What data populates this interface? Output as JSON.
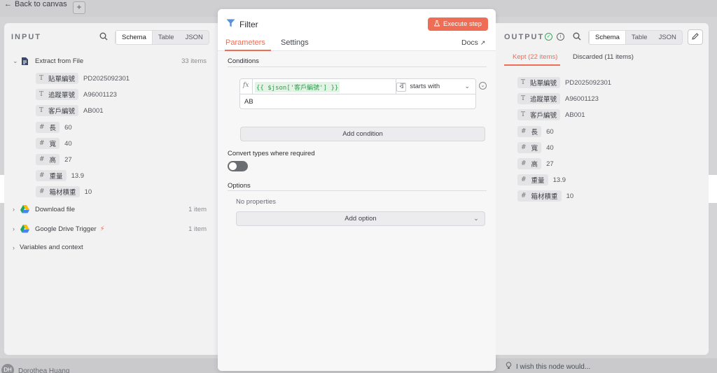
{
  "topbar": {
    "back_label": "Back to canvas",
    "plus": "+"
  },
  "canvas": {
    "user_initials": "DH",
    "user_name": "Dorothea Huang",
    "feedback": "I wish this node would..."
  },
  "input": {
    "title": "INPUT",
    "view_tabs": [
      "Schema",
      "Table",
      "JSON"
    ],
    "active_tab": "Schema",
    "nodes": [
      {
        "name": "Extract from File",
        "count": "33 items",
        "expanded": true
      },
      {
        "name": "Download file",
        "count": "1 item",
        "expanded": false
      },
      {
        "name": "Google Drive Trigger",
        "count": "1 item",
        "expanded": false
      },
      {
        "name": "Variables and context"
      }
    ],
    "fields": [
      {
        "type": "T",
        "name": "貼單編號",
        "value": "PD2025092301"
      },
      {
        "type": "T",
        "name": "追蹤單號",
        "value": "A96001123"
      },
      {
        "type": "T",
        "name": "客戶編號",
        "value": "AB001"
      },
      {
        "type": "#",
        "name": "長",
        "value": "60"
      },
      {
        "type": "#",
        "name": "寬",
        "value": "40"
      },
      {
        "type": "#",
        "name": "高",
        "value": "27"
      },
      {
        "type": "#",
        "name": "重量",
        "value": "13.9"
      },
      {
        "type": "#",
        "name": "箱材積重",
        "value": "10"
      }
    ]
  },
  "modal": {
    "title": "Filter",
    "execute_label": "Execute step",
    "tabs": [
      "Parameters",
      "Settings"
    ],
    "docs_label": "Docs",
    "conditions_label": "Conditions",
    "condition": {
      "fx": "fx",
      "left_value": "{{ $json['客戶編號'] }}",
      "operator_type": "T",
      "operator": "starts with",
      "right_value": "AB"
    },
    "add_condition_label": "Add condition",
    "convert_types_label": "Convert types where required",
    "convert_types_on": false,
    "options_label": "Options",
    "no_properties": "No properties",
    "add_option_label": "Add option"
  },
  "output": {
    "title": "OUTPUT",
    "view_tabs": [
      "Schema",
      "Table",
      "JSON"
    ],
    "active_tab": "Schema",
    "kept_label": "Kept (22 items)",
    "discarded_label": "Discarded (11 items)",
    "fields": [
      {
        "type": "T",
        "name": "貼單編號",
        "value": "PD2025092301"
      },
      {
        "type": "T",
        "name": "追蹤單號",
        "value": "A96001123"
      },
      {
        "type": "T",
        "name": "客戶編號",
        "value": "AB001"
      },
      {
        "type": "#",
        "name": "長",
        "value": "60"
      },
      {
        "type": "#",
        "name": "寬",
        "value": "40"
      },
      {
        "type": "#",
        "name": "高",
        "value": "27"
      },
      {
        "type": "#",
        "name": "重量",
        "value": "13.9"
      },
      {
        "type": "#",
        "name": "箱材積重",
        "value": "10"
      }
    ]
  },
  "colors": {
    "accent": "#ef6d55",
    "success": "#3da35d",
    "panel": "#f2f2f3"
  },
  "icons": [
    "back-arrow-icon",
    "search-icon",
    "filter-icon",
    "flask-icon",
    "external-link-icon",
    "pencil-icon",
    "check-circle-icon",
    "info-icon",
    "file-icon",
    "google-drive-icon",
    "lightning-icon",
    "lightbulb-icon"
  ]
}
